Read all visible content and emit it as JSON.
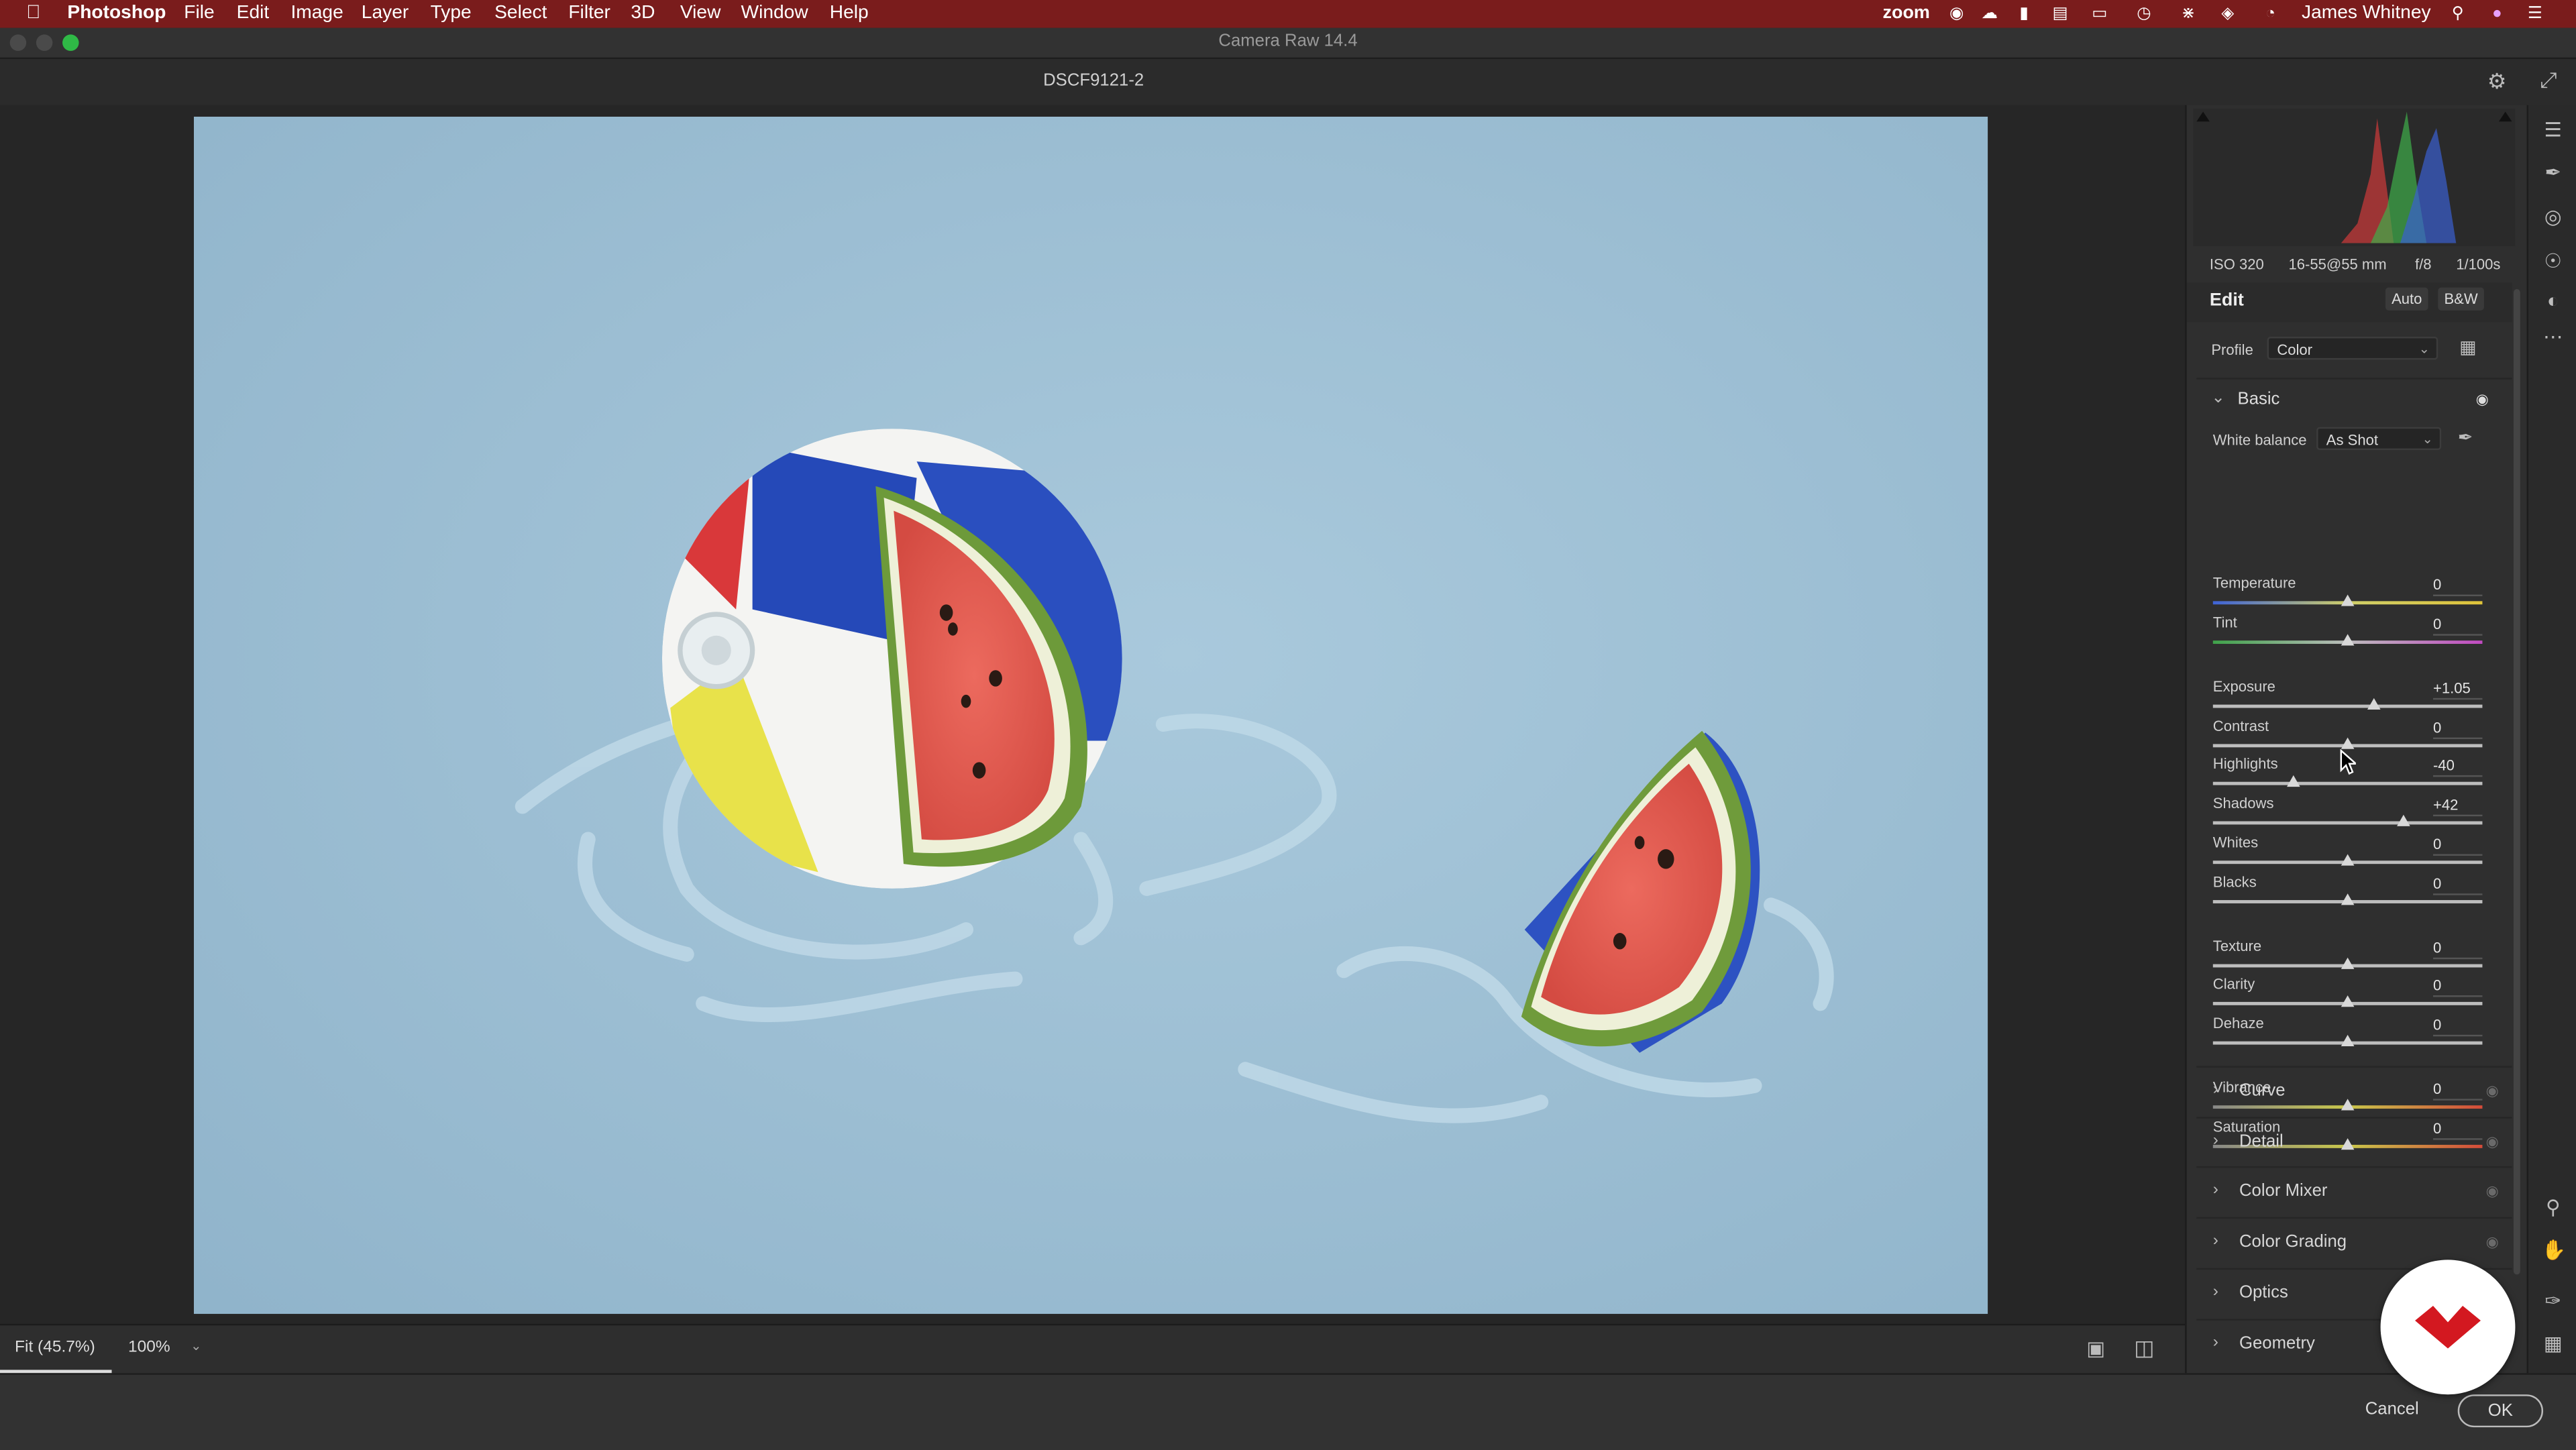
{
  "menubar": {
    "app_name": "Photoshop",
    "items": [
      "File",
      "Edit",
      "Image",
      "Layer",
      "Type",
      "Select",
      "Filter",
      "3D",
      "View",
      "Window",
      "Help"
    ],
    "zoom_label": "zoom",
    "user_name": "James Whitney"
  },
  "window": {
    "title": "Camera Raw 14.4"
  },
  "header": {
    "filename": "DSCF9121-2"
  },
  "exif": {
    "iso": "ISO 320",
    "lens": "16-55@55 mm",
    "aperture": "f/8",
    "shutter": "1/100s"
  },
  "edit": {
    "title": "Edit",
    "auto_label": "Auto",
    "bw_label": "B&W",
    "profile_label": "Profile",
    "profile_value": "Color"
  },
  "basic": {
    "title": "Basic",
    "white_balance_label": "White balance",
    "white_balance_value": "As Shot",
    "sliders": [
      {
        "label": "Temperature",
        "value": "0",
        "pos": 0.5
      },
      {
        "label": "Tint",
        "value": "0",
        "pos": 0.5
      },
      {
        "label": "Exposure",
        "value": "+1.05",
        "pos": 0.6
      },
      {
        "label": "Contrast",
        "value": "0",
        "pos": 0.5
      },
      {
        "label": "Highlights",
        "value": "-40",
        "pos": 0.3
      },
      {
        "label": "Shadows",
        "value": "+42",
        "pos": 0.71
      },
      {
        "label": "Whites",
        "value": "0",
        "pos": 0.5
      },
      {
        "label": "Blacks",
        "value": "0",
        "pos": 0.5
      },
      {
        "label": "Texture",
        "value": "0",
        "pos": 0.5
      },
      {
        "label": "Clarity",
        "value": "0",
        "pos": 0.5
      },
      {
        "label": "Dehaze",
        "value": "0",
        "pos": 0.5
      },
      {
        "label": "Vibrance",
        "value": "0",
        "pos": 0.5
      },
      {
        "label": "Saturation",
        "value": "0",
        "pos": 0.5
      }
    ]
  },
  "sections": [
    "Curve",
    "Detail",
    "Color Mixer",
    "Color Grading",
    "Optics",
    "Geometry"
  ],
  "bottombar": {
    "fit_label": "Fit (45.7%)",
    "zoom_value": "100%"
  },
  "footer": {
    "cancel_label": "Cancel",
    "ok_label": "OK"
  },
  "colors": {
    "menubar": "#7a1c1c",
    "panel": "#2f2f2f",
    "photo_bg": "#9dc0d6"
  }
}
